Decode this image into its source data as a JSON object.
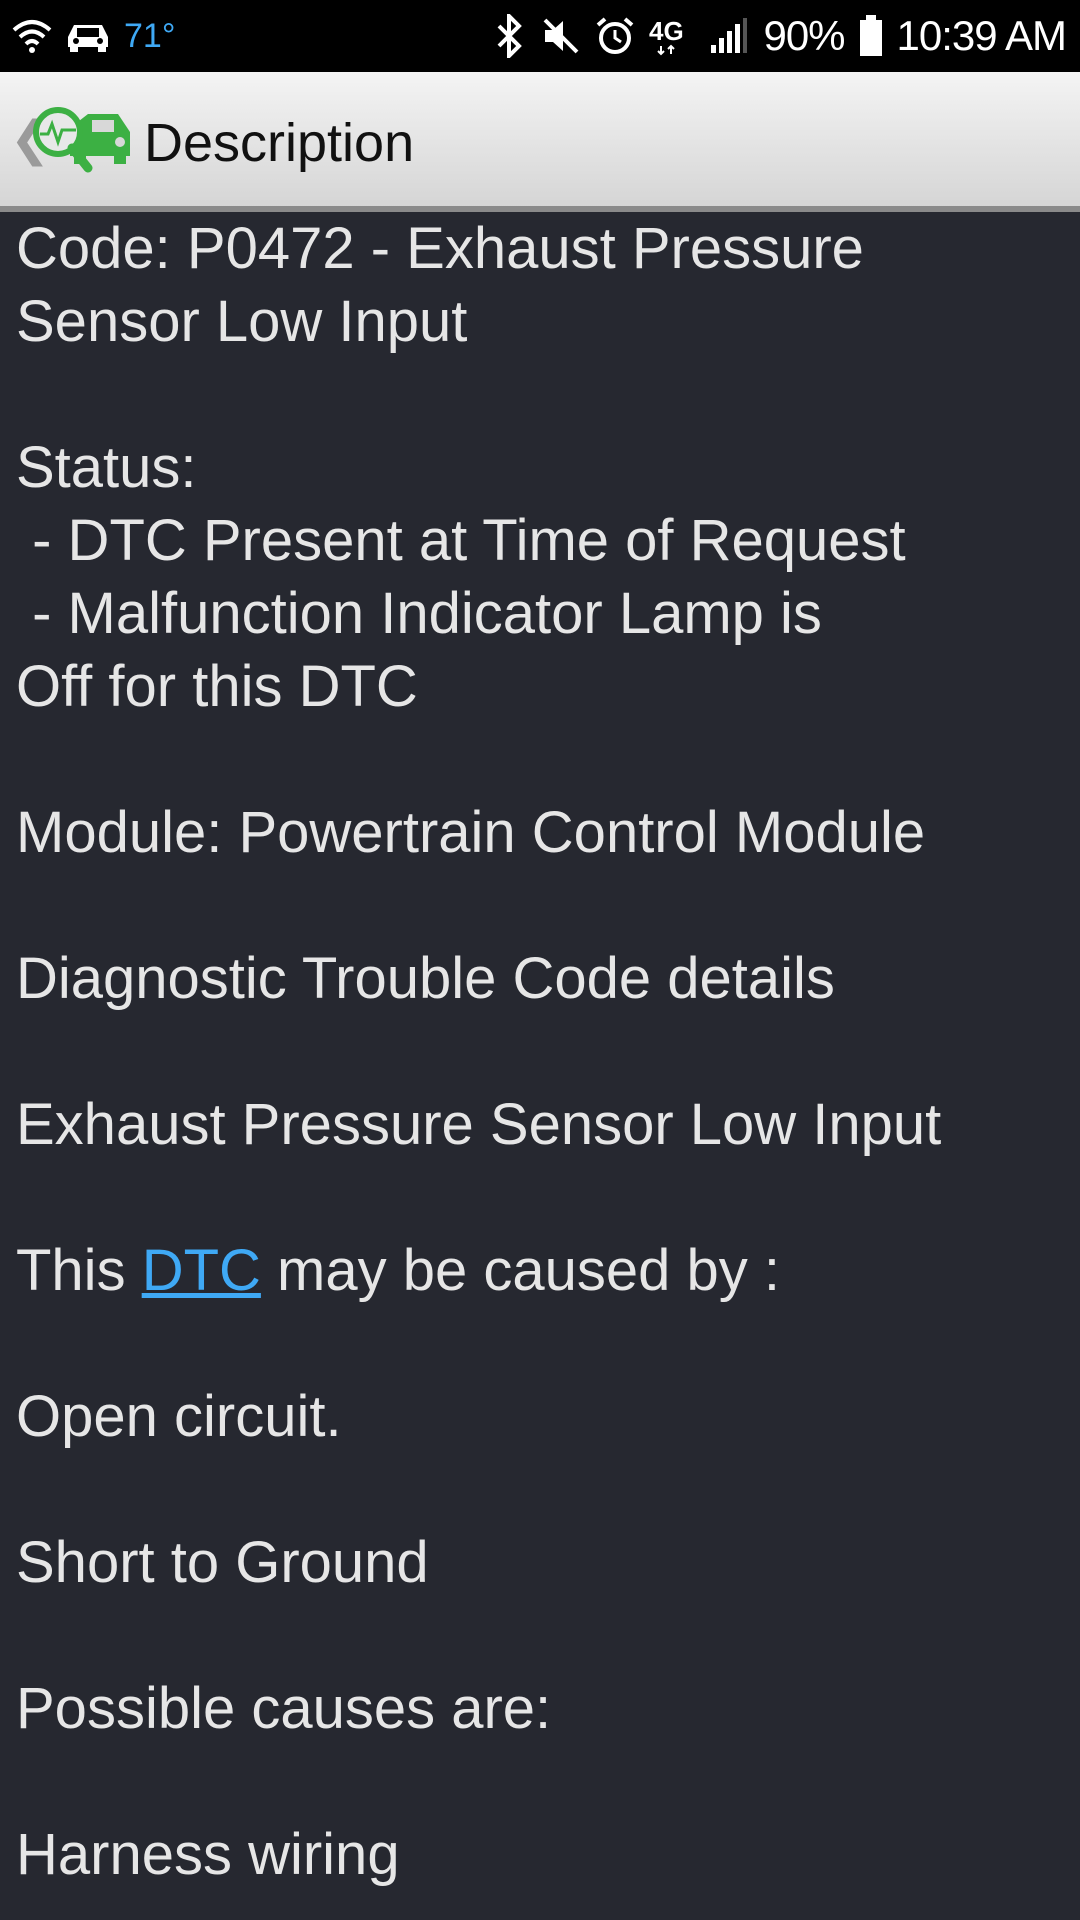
{
  "status_bar": {
    "temperature": "71°",
    "network": "4G",
    "battery": "90%",
    "time": "10:39 AM",
    "icons": [
      "wifi-icon",
      "car-icon",
      "bluetooth-icon",
      "mute-icon",
      "alarm-icon",
      "network-4g-icon",
      "signal-icon",
      "battery-icon"
    ]
  },
  "header": {
    "title": "Description",
    "back_icon": "chevron-left-icon",
    "logo_icon": "car-diagnostic-logo-icon"
  },
  "content": {
    "code_line1": "Code: P0472 - Exhaust Pressure",
    "code_line2": "Sensor Low Input",
    "status_label": "Status:",
    "status_item1": " - DTC Present at Time of Request",
    "status_item2_line1": " - Malfunction Indicator Lamp is",
    "status_item2_line2": "Off for this DTC",
    "module": "Module: Powertrain Control Module",
    "details_heading": "Diagnostic Trouble Code details",
    "details_title": "Exhaust Pressure Sensor Low Input",
    "cause_prefix": "This ",
    "cause_link": "DTC",
    "cause_suffix": " may be caused by :",
    "cause1": "Open circuit.",
    "cause2": "Short to Ground",
    "possible_causes": "Possible causes are:",
    "possible1": "Harness wiring"
  },
  "colors": {
    "background": "#262830",
    "text": "#e6e6e6",
    "link": "#3fa9f5",
    "logo_green": "#3cb043"
  }
}
